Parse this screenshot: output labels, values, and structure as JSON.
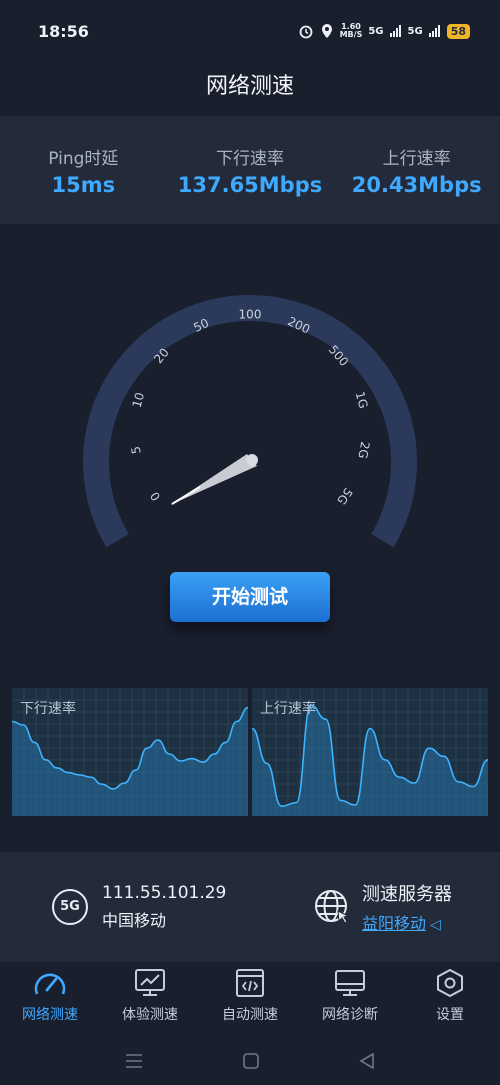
{
  "status_bar": {
    "time": "18:56",
    "net_speed": "1.60",
    "net_unit": "MB/S",
    "sig1": "5G",
    "sig2": "5G",
    "battery": "58"
  },
  "header": {
    "title": "网络测速"
  },
  "stats": [
    {
      "label": "Ping时延",
      "value": "15ms"
    },
    {
      "label": "下行速率",
      "value": "137.65Mbps"
    },
    {
      "label": "上行速率",
      "value": "20.43Mbps"
    }
  ],
  "gauge": {
    "ticks": [
      "0",
      "5",
      "10",
      "20",
      "50",
      "100",
      "200",
      "500",
      "1G",
      "2G",
      "5G"
    ],
    "accent": "#2b3a5a"
  },
  "start_button": {
    "label": "开始测试"
  },
  "graphs": {
    "download": {
      "label": "下行速率",
      "values": [
        0.78,
        0.75,
        0.6,
        0.45,
        0.38,
        0.34,
        0.32,
        0.3,
        0.24,
        0.2,
        0.25,
        0.36,
        0.55,
        0.62,
        0.5,
        0.44,
        0.46,
        0.43,
        0.5,
        0.6,
        0.78,
        0.9
      ]
    },
    "upload": {
      "label": "上行速率",
      "values": [
        0.72,
        0.42,
        0.05,
        0.08,
        0.92,
        0.8,
        0.1,
        0.06,
        0.72,
        0.45,
        0.3,
        0.25,
        0.55,
        0.48,
        0.26,
        0.22,
        0.45
      ]
    }
  },
  "info": {
    "badge": "5G",
    "ip": "111.55.101.29",
    "carrier": "中国移动",
    "server_title": "测速服务器",
    "server_name": "益阳移动"
  },
  "tabs": [
    {
      "label": "网络测速",
      "icon": "speedometer-icon"
    },
    {
      "label": "体验测速",
      "icon": "monitor-chart-icon"
    },
    {
      "label": "自动测速",
      "icon": "code-window-icon"
    },
    {
      "label": "网络诊断",
      "icon": "desktop-icon"
    },
    {
      "label": "设置",
      "icon": "settings-hexagon-icon"
    }
  ],
  "colors": {
    "accent": "#3fa9ff",
    "background": "#1a1f2e",
    "panel": "#232a3a"
  }
}
